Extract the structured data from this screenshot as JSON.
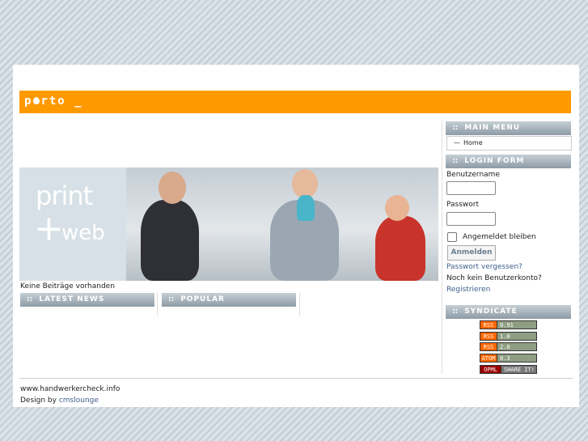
{
  "logo": {
    "text": "p",
    "rest": "rto _"
  },
  "banner": {
    "print": "print",
    "plus": "+",
    "web": "web"
  },
  "content": {
    "no_entries": "Keine Beiträge vorhanden"
  },
  "modules": {
    "latest_news": "LATEST NEWS",
    "popular": "POPULAR",
    "dots": "::"
  },
  "main_menu": {
    "title": "MAIN MENU",
    "items": [
      "Home"
    ]
  },
  "login": {
    "title": "LOGIN FORM",
    "username_label": "Benutzername",
    "password_label": "Passwort",
    "remember_label": "Angemeldet bleiben",
    "submit_label": "Anmelden",
    "forgot_link": "Passwort vergessen?",
    "no_account": "Noch kein Benutzerkonto?",
    "register_link": "Registrieren"
  },
  "syndicate": {
    "title": "SYNDICATE",
    "feeds": [
      {
        "left": "RSS",
        "right": "0.91"
      },
      {
        "left": "RSS",
        "right": "1.0"
      },
      {
        "left": "RSS",
        "right": "2.0"
      },
      {
        "left": "ATOM",
        "right": "0.3"
      },
      {
        "left": "OPML",
        "right": "SHARE IT!"
      }
    ]
  },
  "footer": {
    "site": "www.handwerkercheck.info",
    "design_prefix": "Design by ",
    "design_link": "cmslounge"
  },
  "colors": {
    "accent": "#ff9900",
    "link": "#3d5f8a",
    "module_header": "#8e9ba6"
  }
}
